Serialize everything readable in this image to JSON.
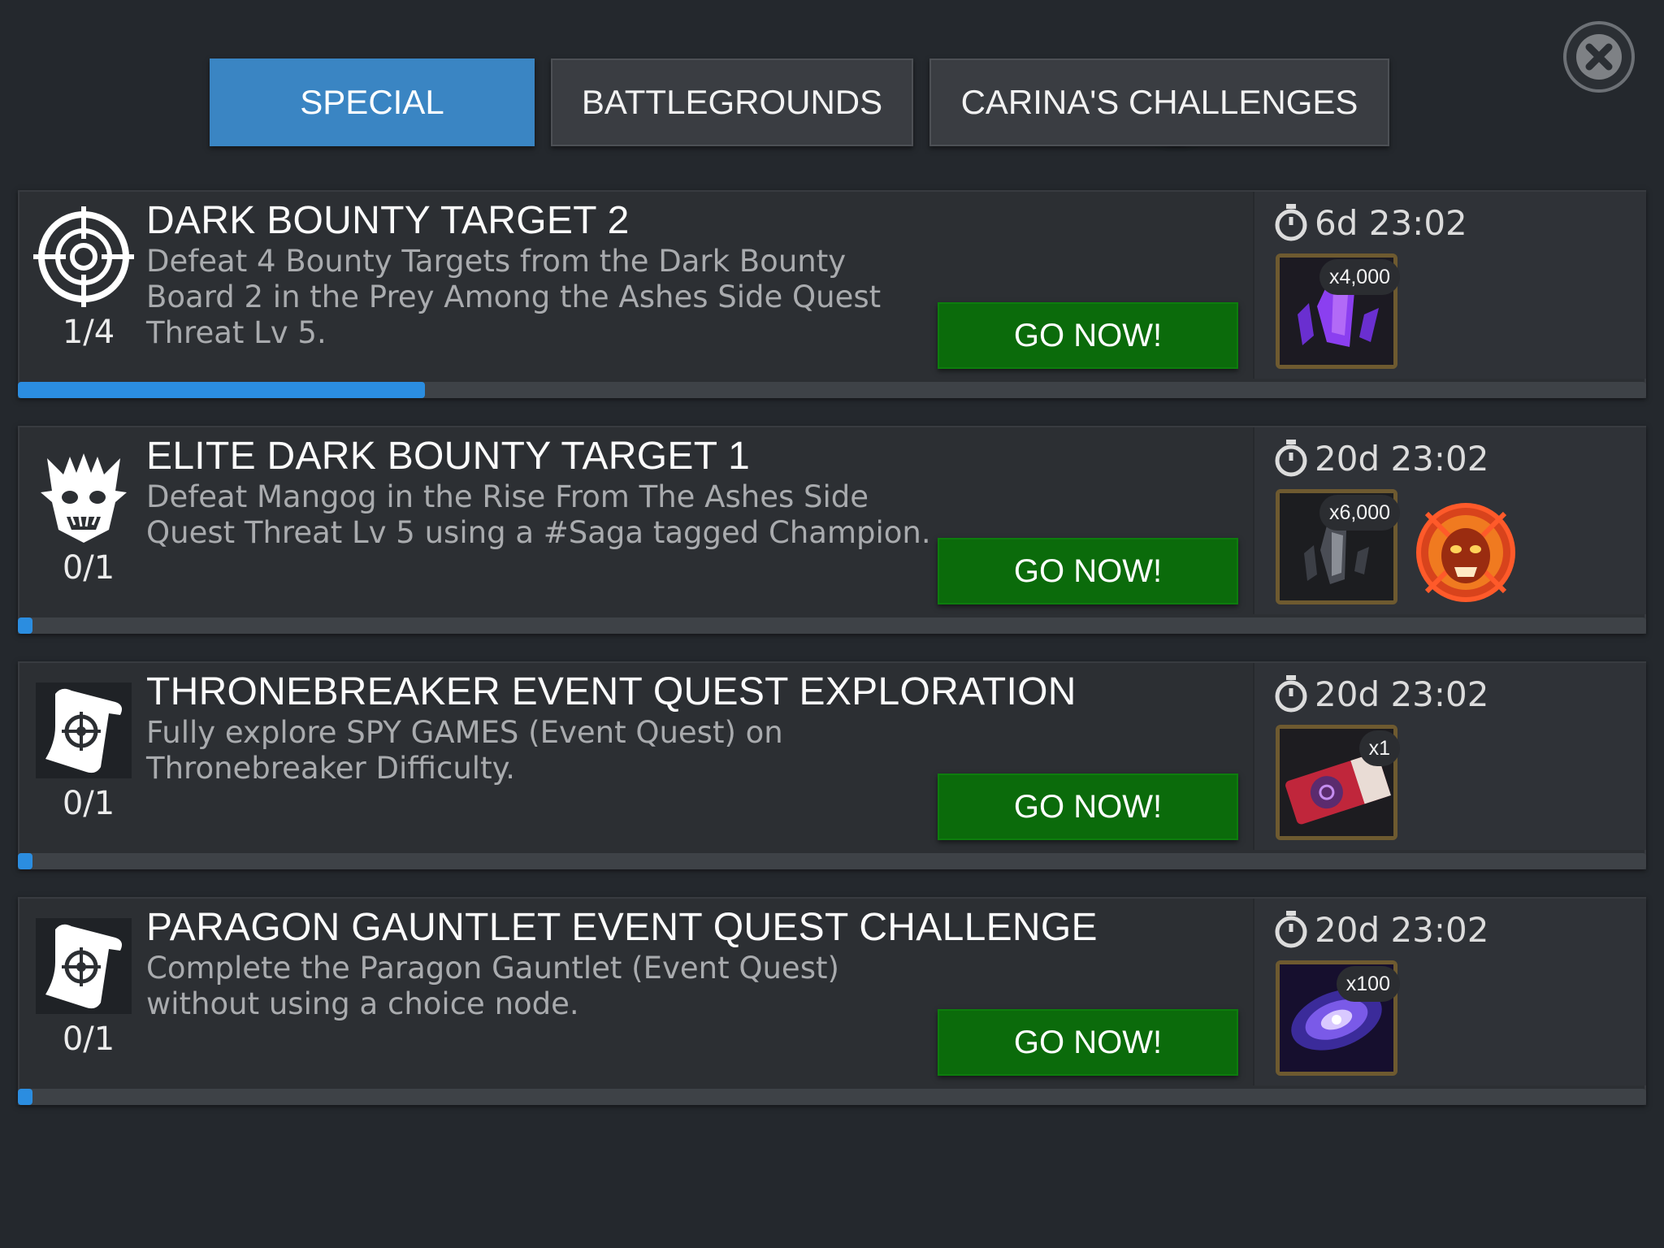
{
  "tabs": [
    {
      "label": "SPECIAL",
      "active": true
    },
    {
      "label": "BATTLEGROUNDS",
      "active": false
    },
    {
      "label": "CARINA'S CHALLENGES",
      "active": false
    }
  ],
  "close_icon": "close-x-icon",
  "colors": {
    "accent": "#3a85c3",
    "go_button": "#0b6b0b",
    "progress_fill": "#2b8de0",
    "background": "#24282d"
  },
  "quests": [
    {
      "title": "DARK BOUNTY TARGET 2",
      "description": "Defeat 4 Bounty Targets from the Dark Bounty Board 2 in the Prey Among the Ashes Side Quest Threat Lv 5.",
      "count": "1/4",
      "progress": 0.25,
      "icon": "crosshair-icon",
      "button": "GO NOW!",
      "timer": "6d 23:02",
      "reward": {
        "qty": "x4,000",
        "icon": "purple-crystal-icon"
      }
    },
    {
      "title": "ELITE DARK BOUNTY TARGET 1",
      "description": "Defeat Mangog in the Rise From The Ashes Side Quest Threat Lv 5 using a #Saga tagged Champion.",
      "count": "0/1",
      "progress": 0.0,
      "icon": "mangog-head-icon",
      "button": "GO NOW!",
      "timer": "20d 23:02",
      "reward": {
        "qty": "x6,000",
        "icon": "dark-crystal-icon"
      },
      "extra_reward": "mangog-bounty-badge-icon"
    },
    {
      "title": "THRONEBREAKER EVENT QUEST EXPLORATION",
      "description": "Fully explore SPY GAMES (Event Quest) on Thronebreaker Difficulty.",
      "count": "0/1",
      "progress": 0.0,
      "icon": "scroll-crosshair-icon",
      "button": "GO NOW!",
      "timer": "20d 23:02",
      "reward": {
        "qty": "x1",
        "icon": "ticket-icon"
      }
    },
    {
      "title": "PARAGON GAUNTLET EVENT QUEST CHALLENGE",
      "description": "Complete the Paragon Gauntlet (Event Quest) without using a choice node.",
      "count": "0/1",
      "progress": 0.0,
      "icon": "scroll-crosshair-icon",
      "button": "GO NOW!",
      "timer": "20d 23:02",
      "reward": {
        "qty": "x100",
        "icon": "galaxy-icon"
      }
    }
  ]
}
